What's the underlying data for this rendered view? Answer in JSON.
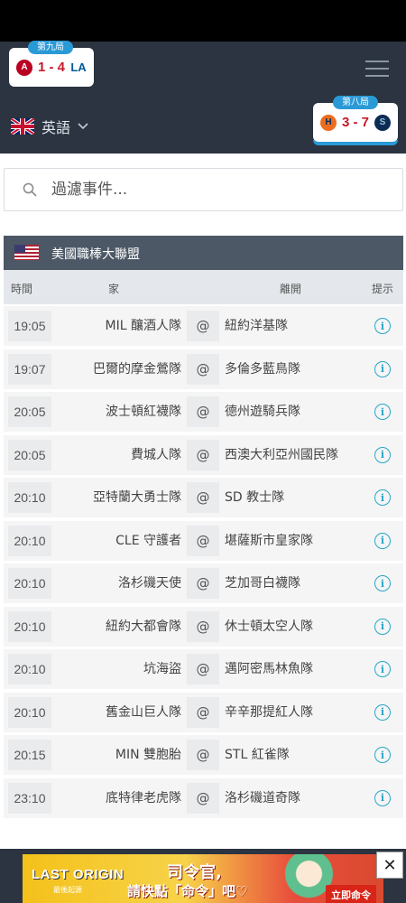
{
  "live_scores": [
    {
      "inning": "第九局",
      "score": "1 - 4",
      "home_logo": "angels-logo",
      "away_logo": "dodgers-logo"
    },
    {
      "inning": "第八局",
      "score": "3 - 7",
      "home_logo": "astros-logo",
      "away_logo": "mariners-logo"
    }
  ],
  "language": {
    "label": "英語",
    "flag": "uk-flag-icon"
  },
  "search": {
    "placeholder": "過濾事件..."
  },
  "league": {
    "name": "美國職棒大聯盟",
    "flag": "us-flag-icon"
  },
  "columns": {
    "time": "時間",
    "home": "家",
    "away": "離開",
    "tip": "提示"
  },
  "games": [
    {
      "time": "19:05",
      "home": "MIL 釀酒人隊",
      "at": "@",
      "away": "紐約洋基隊",
      "tip": "i"
    },
    {
      "time": "19:07",
      "home": "巴爾的摩金鶯隊",
      "at": "@",
      "away": "多倫多藍鳥隊",
      "tip": "i"
    },
    {
      "time": "20:05",
      "home": "波士頓紅襪隊",
      "at": "@",
      "away": "德州遊騎兵隊",
      "tip": "i"
    },
    {
      "time": "20:05",
      "home": "費城人隊",
      "at": "@",
      "away": "西澳大利亞州國民隊",
      "tip": "i"
    },
    {
      "time": "20:10",
      "home": "亞特蘭大勇士隊",
      "at": "@",
      "away": "SD 教士隊",
      "tip": "i"
    },
    {
      "time": "20:10",
      "home": "CLE 守護者",
      "at": "@",
      "away": "堪薩斯市皇家隊",
      "tip": "i"
    },
    {
      "time": "20:10",
      "home": "洛杉磯天使",
      "at": "@",
      "away": "芝加哥白襪隊",
      "tip": "i"
    },
    {
      "time": "20:10",
      "home": "紐約大都會隊",
      "at": "@",
      "away": "休士頓太空人隊",
      "tip": "i"
    },
    {
      "time": "20:10",
      "home": "坑海盜",
      "at": "@",
      "away": "邁阿密馬林魚隊",
      "tip": "i"
    },
    {
      "time": "20:10",
      "home": "舊金山巨人隊",
      "at": "@",
      "away": "辛辛那提紅人隊",
      "tip": "i"
    },
    {
      "time": "20:15",
      "home": "MIN 雙胞胎",
      "at": "@",
      "away": "STL 紅雀隊",
      "tip": "i"
    },
    {
      "time": "23:10",
      "home": "底特律老虎隊",
      "at": "@",
      "away": "洛杉磯道奇隊",
      "tip": "i"
    }
  ],
  "ad": {
    "brand": "LAST ORIGIN",
    "brand_sub": "最後起源",
    "line1": "司令官,",
    "line2": "請快點「命令」吧♡",
    "cta": "立即命令",
    "close": "✕"
  },
  "colors": {
    "accent": "#2a9ad6",
    "header_bg": "#2b3440",
    "league_bg": "#4c5866",
    "score_red": "#c8192c",
    "info_teal": "#27a7c9"
  }
}
